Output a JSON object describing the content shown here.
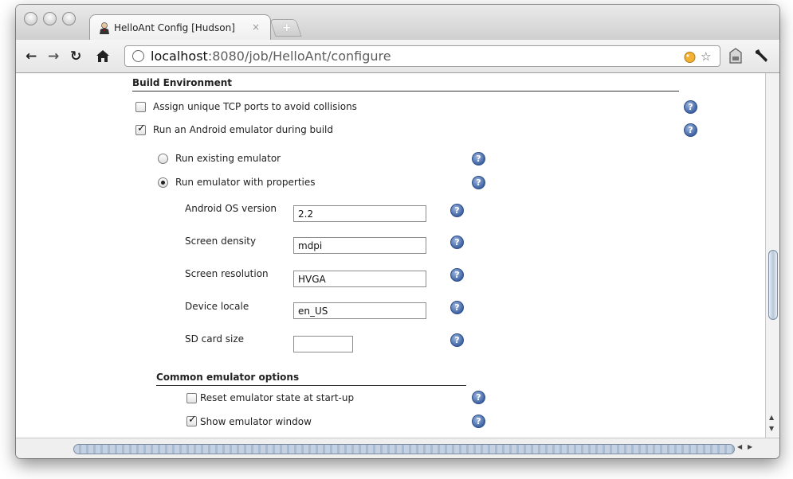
{
  "browser": {
    "tab_title": "HelloAnt Config [Hudson]",
    "tab_close": "×",
    "new_tab": "+",
    "url_host": "localhost",
    "url_path": ":8080/job/HelloAnt/configure"
  },
  "build_environment": {
    "title": "Build Environment",
    "assign_ports": {
      "label": "Assign unique TCP ports to avoid collisions",
      "checked": false
    },
    "run_emulator": {
      "label": "Run an Android emulator during build",
      "checked": true
    },
    "run_existing": {
      "label": "Run existing emulator",
      "selected": false
    },
    "run_with_properties": {
      "label": "Run emulator with properties",
      "selected": true
    },
    "fields": [
      {
        "label": "Android OS version",
        "value": "2.2"
      },
      {
        "label": "Screen density",
        "value": "mdpi"
      },
      {
        "label": "Screen resolution",
        "value": "HVGA"
      },
      {
        "label": "Device locale",
        "value": "en_US"
      },
      {
        "label": "SD card size",
        "value": ""
      }
    ]
  },
  "common_options": {
    "title": "Common emulator options",
    "reset_state": {
      "label": "Reset emulator state at start-up",
      "checked": false
    },
    "show_window": {
      "label": "Show emulator window",
      "checked": true
    }
  },
  "icons": {
    "help": "?",
    "check": "✓"
  }
}
